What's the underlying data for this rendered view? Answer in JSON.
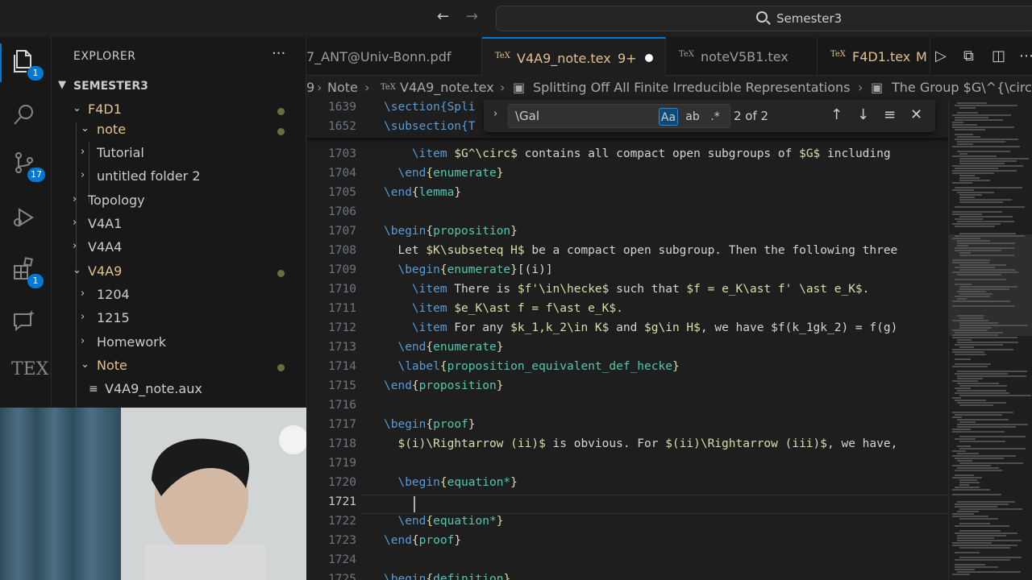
{
  "titlebar": {
    "back_icon": "arrow-left-icon",
    "forward_icon": "arrow-right-icon",
    "search_text": "Semester3"
  },
  "activity": {
    "explorer_badge": "1",
    "scm_badge": "17",
    "extensions_badge": "1",
    "tex_label": "TEX"
  },
  "sidebar": {
    "title": "EXPLORER",
    "more": "···",
    "root": "SEMESTER3",
    "items": [
      {
        "label": "F4D1",
        "expanded": true,
        "modified": true
      },
      {
        "label": "note",
        "expanded": true,
        "modified": true
      },
      {
        "label": "Tutorial",
        "expanded": false
      },
      {
        "label": "untitled folder 2",
        "expanded": false
      },
      {
        "label": "Topology",
        "expanded": false
      },
      {
        "label": "V4A1",
        "expanded": false
      },
      {
        "label": "V4A4",
        "expanded": false
      },
      {
        "label": "V4A9",
        "expanded": true,
        "modified": true
      },
      {
        "label": "1204",
        "expanded": false
      },
      {
        "label": "1215",
        "expanded": false
      },
      {
        "label": "Homework",
        "expanded": false
      },
      {
        "label": "Note",
        "expanded": true,
        "modified": true
      },
      {
        "label": "V4A9_note.aux",
        "file": true
      }
    ]
  },
  "tabs": [
    {
      "label": "7_ANT@Univ-Bonn.pdf"
    },
    {
      "label": "V4A9_note.tex",
      "badge": "9+",
      "active": true,
      "dirty": true
    },
    {
      "label": "noteV5B1.tex"
    },
    {
      "label": "F4D1.tex",
      "badge": "M"
    }
  ],
  "breadcrumbs": [
    "9",
    "Note",
    "V4A9_note.tex",
    "Splitting Off All Finite Irreducible Representations",
    "The Group $G\\^{\\circ}"
  ],
  "find": {
    "query": "\\Gal",
    "match_case": "Aa",
    "whole_word": "ab",
    "regex": ".*",
    "count": "2 of 2"
  },
  "editor": {
    "sticky_lines": [
      {
        "num": "1639",
        "text": "\\section{Spli"
      },
      {
        "num": "1652",
        "text": "\\subsection{T"
      }
    ],
    "lines": [
      {
        "num": "1703",
        "text": "    \\item $G^\\circ$ contains all compact open subgroups of $G$ including"
      },
      {
        "num": "1704",
        "text": "  \\end{enumerate}"
      },
      {
        "num": "1705",
        "text": "\\end{lemma}"
      },
      {
        "num": "1706",
        "text": ""
      },
      {
        "num": "1707",
        "text": "\\begin{proposition}"
      },
      {
        "num": "1708",
        "text": "  Let $K\\subseteq H$ be a compact open subgroup. Then the following three"
      },
      {
        "num": "1709",
        "text": "  \\begin{enumerate}[(i)]"
      },
      {
        "num": "1710",
        "text": "    \\item There is $f'\\in\\hecke$ such that $f = e_K\\ast f' \\ast e_K$."
      },
      {
        "num": "1711",
        "text": "    \\item $e_K\\ast f = f\\ast e_K$."
      },
      {
        "num": "1712",
        "text": "    \\item For any $k_1,k_2\\in K$ and $g\\in H$, we have $f(k_1gk_2) = f(g)"
      },
      {
        "num": "1713",
        "text": "  \\end{enumerate}"
      },
      {
        "num": "1714",
        "text": "  \\label{proposition_equivalent_def_hecke}"
      },
      {
        "num": "1715",
        "text": "\\end{proposition}"
      },
      {
        "num": "1716",
        "text": ""
      },
      {
        "num": "1717",
        "text": "\\begin{proof}"
      },
      {
        "num": "1718",
        "text": "  $(i)\\Rightarrow (ii)$ is obvious. For $(ii)\\Rightarrow (iii)$, we have,"
      },
      {
        "num": "1719",
        "text": ""
      },
      {
        "num": "1720",
        "text": "  \\begin{equation*}"
      },
      {
        "num": "1721",
        "text": "    "
      },
      {
        "num": "1722",
        "text": "  \\end{equation*}"
      },
      {
        "num": "1723",
        "text": "\\end{proof}"
      },
      {
        "num": "1724",
        "text": ""
      },
      {
        "num": "1725",
        "text": "\\begin{definition}"
      }
    ]
  },
  "colors": {
    "accent": "#0078d4",
    "modified": "#e2c08d",
    "keyword": "#569cd6",
    "environment": "#4ec9b0"
  }
}
